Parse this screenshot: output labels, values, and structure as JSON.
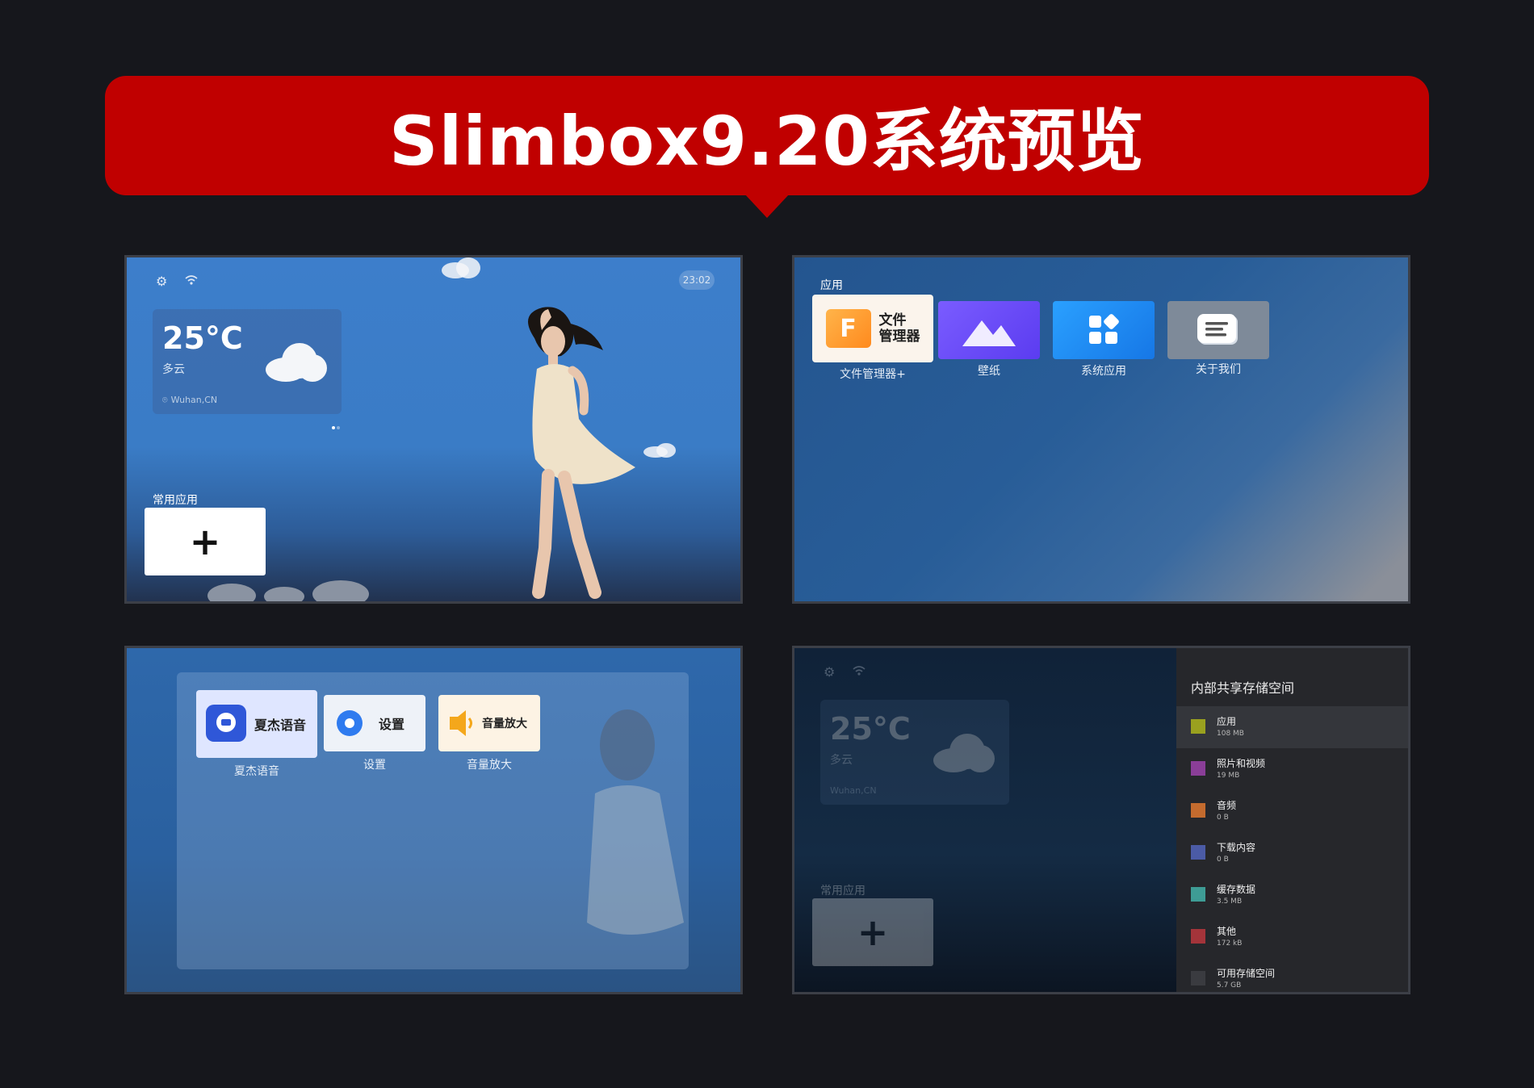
{
  "banner": {
    "title": "Slimbox9.20系统预览"
  },
  "home": {
    "clock": "23:02",
    "weather": {
      "temp": "25°C",
      "condition": "多云",
      "location": "Wuhan,CN"
    },
    "section_label": "常用应用",
    "add_label": "+"
  },
  "apps": {
    "section_label": "应用",
    "file_manager_tile_text_1": "文件",
    "file_manager_tile_text_2": "管理器",
    "file_manager_icon_letter": "F",
    "items": [
      {
        "label": "文件管理器+"
      },
      {
        "label": "壁纸"
      },
      {
        "label": "系统应用"
      },
      {
        "label": "关于我们"
      }
    ]
  },
  "folder": {
    "items": [
      {
        "label": "夏杰语音",
        "tile_text": "夏杰语音"
      },
      {
        "label": "设置",
        "tile_text": "设置"
      },
      {
        "label": "音量放大",
        "tile_text": "音量放大"
      }
    ]
  },
  "storage": {
    "title": "内部共享存储空间",
    "items": [
      {
        "name": "应用",
        "size": "108 MB",
        "color": "#9aa11f"
      },
      {
        "name": "照片和视频",
        "size": "19 MB",
        "color": "#8a3e98"
      },
      {
        "name": "音频",
        "size": "0 B",
        "color": "#c46b2e"
      },
      {
        "name": "下载内容",
        "size": "0 B",
        "color": "#4b5ba6"
      },
      {
        "name": "缓存数据",
        "size": "3.5 MB",
        "color": "#3e9c95"
      },
      {
        "name": "其他",
        "size": "172 kB",
        "color": "#a4343a"
      },
      {
        "name": "可用存储空间",
        "size": "5.7 GB",
        "color": "#3a3b40"
      }
    ]
  },
  "colors": {
    "banner": "#c00000",
    "background": "#16171c"
  }
}
